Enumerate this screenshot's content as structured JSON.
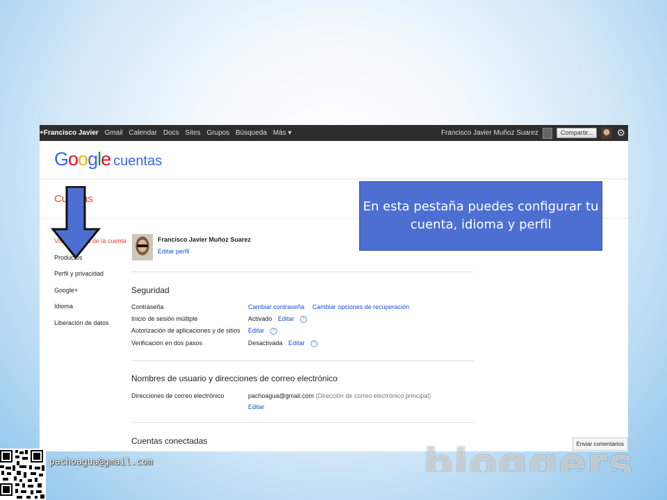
{
  "top_bar": {
    "links": [
      "+Francisco Javier",
      "Gmail",
      "Calendar",
      "Docs",
      "Sites",
      "Grupos",
      "Búsqueda",
      "Más ▾"
    ],
    "user_name": "Francisco Javier Muñoz Suarez",
    "share_label": "Compartir...",
    "settings_icon": "gear-icon"
  },
  "header": {
    "logo_letters": [
      "G",
      "o",
      "o",
      "g",
      "l",
      "e"
    ],
    "logo_subtitle": "cuentas",
    "page_title": "Cuentas"
  },
  "sidebar": {
    "items": [
      "Vista general de la cuenta",
      "Productos",
      "Perfil y privacidad",
      "Google+",
      "Idioma",
      "Liberación de datos"
    ]
  },
  "profile": {
    "name": "Francisco Javier Muñoz Suarez",
    "edit_link": "Editar perfil"
  },
  "security": {
    "title": "Seguridad",
    "rows": [
      {
        "label": "Contraseña",
        "link1": "Cambiar contraseña",
        "link2": "Cambiar opciones de recuperación"
      },
      {
        "label": "Inicio de sesión múltiple",
        "status": "Activado",
        "link": "Editar",
        "help": "?"
      },
      {
        "label": "Autorización de aplicaciones y de sitios",
        "link": "Editar",
        "help": "?"
      },
      {
        "label": "Verificación en dos pasos",
        "status": "Desactivada",
        "link": "Editar",
        "help": "?"
      }
    ]
  },
  "emails": {
    "title": "Nombres de usuario y direcciones de correo electrónico",
    "label": "Direcciones de correo electrónico",
    "address": "pachoagua@gmail.com",
    "note": "(Dirección de correo electrónico principal)",
    "edit_link": "Editar"
  },
  "connected": {
    "title": "Cuentas conectadas"
  },
  "feedback_button": "Enviar comentarios",
  "callout_text": "En esta pestaña puedes configurar tu cuenta, idioma y perfil",
  "footer": {
    "email": "pachoagua@gmail.com",
    "watermark": "bloggers"
  },
  "colors": {
    "callout_bg": "#4d6fd1",
    "arrow_fill": "#4d6fd1",
    "link": "#1155cc",
    "title_red": "#dd4b39",
    "bar_bg": "#2d2d2d"
  }
}
